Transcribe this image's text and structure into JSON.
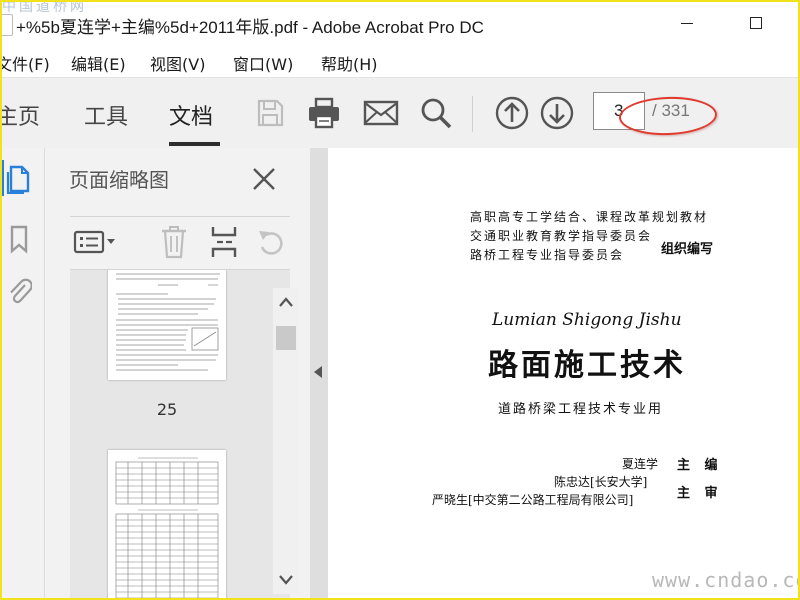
{
  "watermarks": {
    "top_left": "中国道桥网",
    "bottom_right": "www.cndao.com"
  },
  "window": {
    "title": "+%5b夏连学+主编%5d+2011年版.pdf - Adobe Acrobat Pro DC"
  },
  "menu": [
    {
      "label": "文件(F)"
    },
    {
      "label": "编辑(E)"
    },
    {
      "label": "视图(V)"
    },
    {
      "label": "窗口(W)"
    },
    {
      "label": "帮助(H)"
    }
  ],
  "toolbar": {
    "tabs": [
      {
        "label": "主页"
      },
      {
        "label": "工具"
      },
      {
        "label": "文档"
      }
    ],
    "active_tab": "文档",
    "icons": [
      "save-icon",
      "print-icon",
      "email-icon",
      "search-icon",
      "page-up-icon",
      "page-down-icon"
    ],
    "page_current": "3",
    "page_total": "/ 331"
  },
  "sidebar": {
    "title": "页面缩略图",
    "rail_icons": [
      "page-thumbnails-icon",
      "bookmark-icon",
      "attachment-icon"
    ],
    "tool_icons": [
      "options-menu-icon",
      "delete-icon",
      "insert-pages-icon",
      "undo-icon"
    ],
    "thumbnail_page_label": "25"
  },
  "document": {
    "org_lines": [
      "高职高专工学结合、课程改革规划教材",
      "交通职业教育教学指导委员会",
      "路桥工程专业指导委员会"
    ],
    "org_role": "组织编写",
    "pinyin_title": "Lumian Shigong Jishu",
    "title": "路面施工技术",
    "subtitle": "道路桥梁工程技术专业用",
    "editor_name": "夏连学",
    "editor_role": "主 编",
    "reviewers": [
      "陈忠达[长安大学]",
      "严晓生[中交第二公路工程局有限公司]"
    ],
    "reviewer_role": "主 审"
  },
  "colors": {
    "accent": "#2980d9",
    "highlight_ellipse": "#e0392e",
    "frame": "#f2e21c"
  }
}
